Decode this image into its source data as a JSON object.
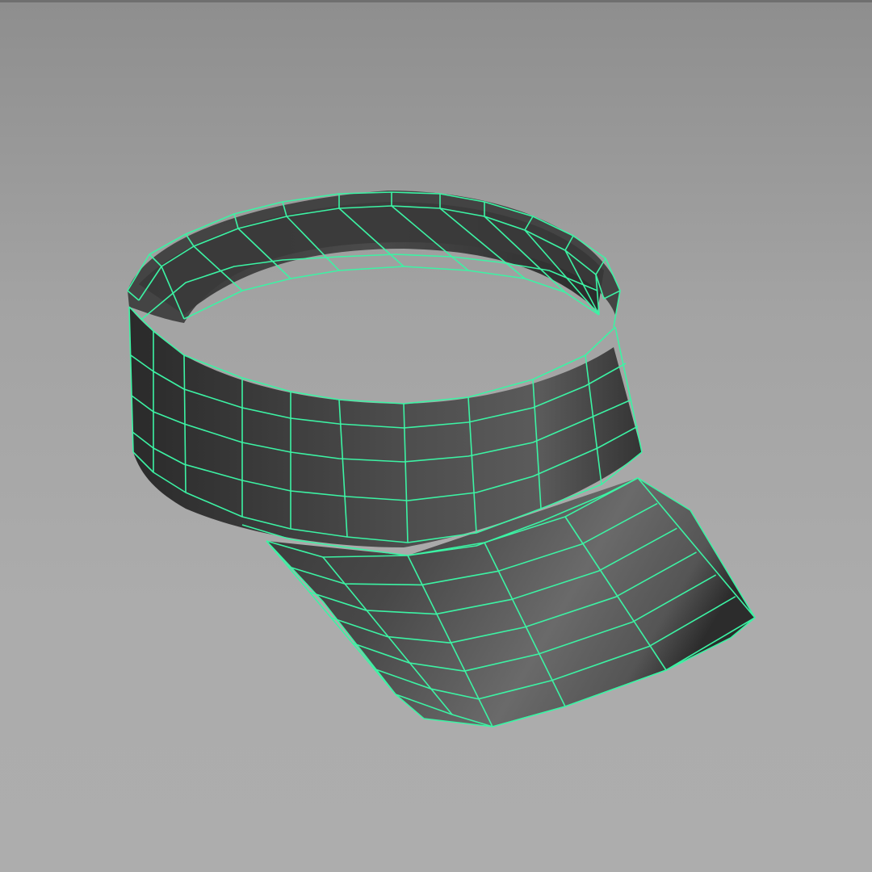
{
  "viewport": {
    "background_top": "#8e8e8e",
    "background_bottom": "#adadad",
    "wireframe_color": "#3cf3a4",
    "mesh_shade_light": "#6e6e6e",
    "mesh_shade_dark": "#262626"
  },
  "model": {
    "object": "sun-visor-mesh",
    "display_mode": "wireframe-on-shaded"
  }
}
